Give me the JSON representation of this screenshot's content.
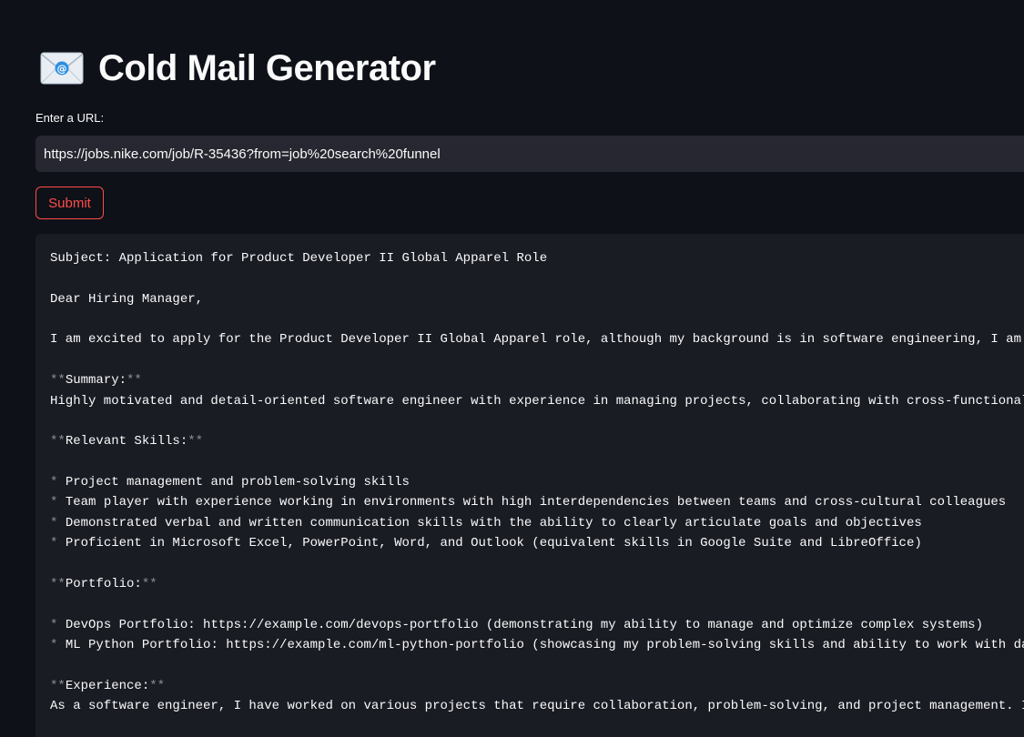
{
  "header": {
    "icon": "incoming-envelope-icon",
    "title": "Cold Mail Generator"
  },
  "form": {
    "url_label": "Enter a URL:",
    "url_value": "https://jobs.nike.com/job/R-35436?from=job%20search%20funnel",
    "submit_label": "Submit"
  },
  "colors": {
    "background": "#0e1117",
    "input_background": "#262730",
    "code_background": "#1a1c24",
    "accent": "#ff4b4b",
    "text": "#fafafa",
    "dim_text": "#8b8d98"
  },
  "email": {
    "subject": "Subject: Application for Product Developer II Global Apparel Role",
    "greeting": "Dear Hiring Manager,",
    "intro": "I am excited to apply for the Product Developer II Global Apparel role, although my background is in software engineering, I am",
    "markdown_marker": "**",
    "summary_heading": "Summary:",
    "summary_text": "Highly motivated and detail-oriented software engineer with experience in managing projects, collaborating with cross-functional",
    "skills_heading": "Relevant Skills:",
    "bullet": "*",
    "skills": [
      "Project management and problem-solving skills",
      "Team player with experience working in environments with high interdependencies between teams and cross-cultural colleagues",
      "Demonstrated verbal and written communication skills with the ability to clearly articulate goals and objectives",
      "Proficient in Microsoft Excel, PowerPoint, Word, and Outlook (equivalent skills in Google Suite and LibreOffice)"
    ],
    "portfolio_heading": "Portfolio:",
    "portfolio": [
      "DevOps Portfolio: https://example.com/devops-portfolio (demonstrating my ability to manage and optimize complex systems)",
      "ML Python Portfolio: https://example.com/ml-python-portfolio (showcasing my problem-solving skills and ability to work with da"
    ],
    "experience_heading": "Experience:",
    "experience_text": "As a software engineer, I have worked on various projects that require collaboration, problem-solving, and project management. I"
  }
}
